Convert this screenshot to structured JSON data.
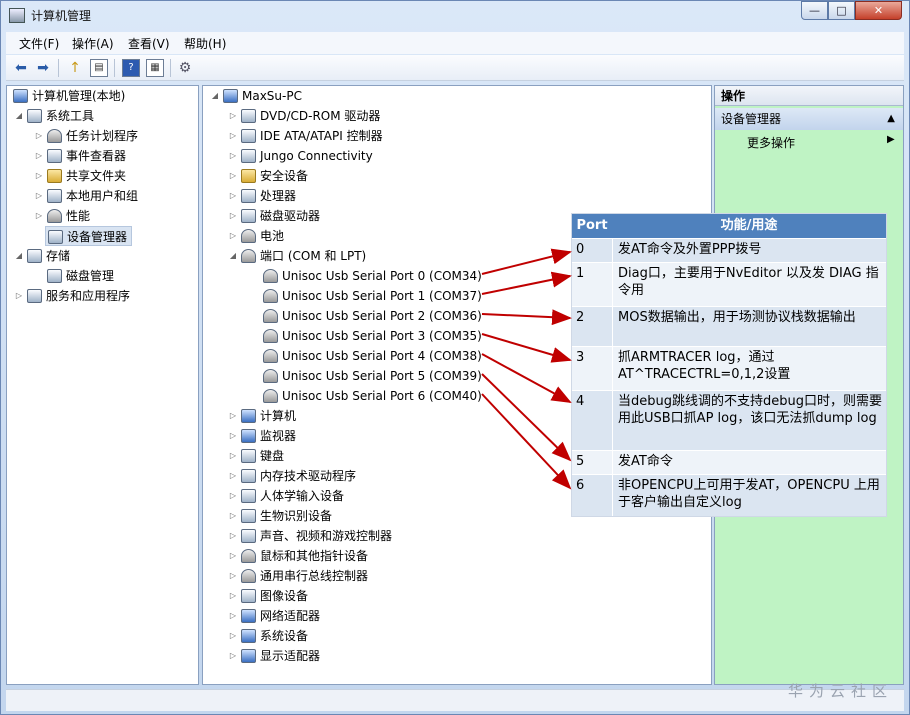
{
  "window": {
    "title": "计算机管理"
  },
  "window_controls": {
    "minimize": "—",
    "maximize": "□",
    "close": "✕"
  },
  "menu": [
    "文件(F)",
    "操作(A)",
    "查看(V)",
    "帮助(H)"
  ],
  "toolbar": {
    "icons": [
      "back-arrow-icon",
      "forward-arrow-icon",
      "up-folder-icon",
      "show-hide-tree-icon",
      "help-icon",
      "properties-icon",
      "scan-hardware-icon"
    ],
    "glyphs": [
      "⬅",
      "➡",
      "↑",
      "▤",
      "?",
      "▦",
      "⚙"
    ]
  },
  "left_tree": {
    "root": "计算机管理(本地)",
    "items": [
      {
        "label": "系统工具",
        "level": 1,
        "expanded": true
      },
      {
        "label": "任务计划程序",
        "level": 2
      },
      {
        "label": "事件查看器",
        "level": 2
      },
      {
        "label": "共享文件夹",
        "level": 2
      },
      {
        "label": "本地用户和组",
        "level": 2
      },
      {
        "label": "性能",
        "level": 2
      },
      {
        "label": "设备管理器",
        "level": 2,
        "selected": true
      },
      {
        "label": "存储",
        "level": 1,
        "expanded": true
      },
      {
        "label": "磁盘管理",
        "level": 2
      },
      {
        "label": "服务和应用程序",
        "level": 1
      }
    ]
  },
  "device_tree": {
    "root": "MaxSu-PC",
    "categories_before": [
      "DVD/CD-ROM 驱动器",
      "IDE ATA/ATAPI 控制器",
      "Jungo Connectivity",
      "安全设备",
      "处理器",
      "磁盘驱动器",
      "电池"
    ],
    "ports_category": "端口 (COM 和 LPT)",
    "ports": [
      "Unisoc Usb Serial Port 0 (COM34)",
      "Unisoc Usb Serial Port 1 (COM37)",
      "Unisoc Usb Serial Port 2 (COM36)",
      "Unisoc Usb Serial Port 3 (COM35)",
      "Unisoc Usb Serial Port 4 (COM38)",
      "Unisoc Usb Serial Port 5 (COM39)",
      "Unisoc Usb Serial Port 6 (COM40)"
    ],
    "categories_after": [
      "计算机",
      "监视器",
      "键盘",
      "内存技术驱动程序",
      "人体学输入设备",
      "生物识别设备",
      "声音、视频和游戏控制器",
      "鼠标和其他指针设备",
      "通用串行总线控制器",
      "图像设备",
      "网络适配器",
      "系统设备",
      "显示适配器"
    ]
  },
  "actions": {
    "header": "操作",
    "section": "设备管理器",
    "more": "更多操作"
  },
  "annotation": {
    "header_port": "Port",
    "header_func": "功能/用途",
    "rows": [
      {
        "port": "0",
        "desc": "发AT命令及外置PPP拨号"
      },
      {
        "port": "1",
        "desc": "Diag口，主要用于NvEditor 以及发 DIAG 指令用"
      },
      {
        "port": "2",
        "desc": "MOS数据输出，用于场测协议栈数据输出"
      },
      {
        "port": "3",
        "desc": "抓ARMTRACER log，通过 AT^TRACECTRL=0,1,2设置"
      },
      {
        "port": "4",
        "desc": "当debug跳线调的不支持debug口时，则需要用此USB口抓AP log，该口无法抓dump log"
      },
      {
        "port": "5",
        "desc": "发AT命令"
      },
      {
        "port": "6",
        "desc": "非OPENCPU上可用于发AT，OPENCPU 上用于客户输出自定义log"
      }
    ],
    "arrow_color": "#c00000"
  },
  "watermark": "华为云社区"
}
